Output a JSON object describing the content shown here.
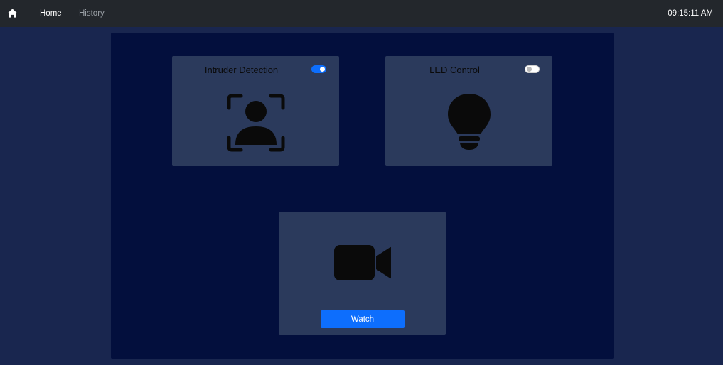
{
  "nav": {
    "home_icon": "home-icon",
    "links": [
      {
        "label": "Home",
        "active": true
      },
      {
        "label": "History",
        "active": false
      }
    ],
    "time": "09:15:11 AM"
  },
  "cards": {
    "intruder": {
      "title": "Intruder Detection",
      "toggle_on": true,
      "icon": "person-scan-icon"
    },
    "led": {
      "title": "LED Control",
      "toggle_on": false,
      "icon": "lightbulb-icon"
    },
    "camera": {
      "icon": "video-camera-icon",
      "button_label": "Watch"
    }
  },
  "colors": {
    "navbar_bg": "#23272c",
    "page_bg": "#19264f",
    "panel_bg": "#030f3d",
    "card_bg": "#2b3a5c",
    "accent": "#0d6efd"
  }
}
